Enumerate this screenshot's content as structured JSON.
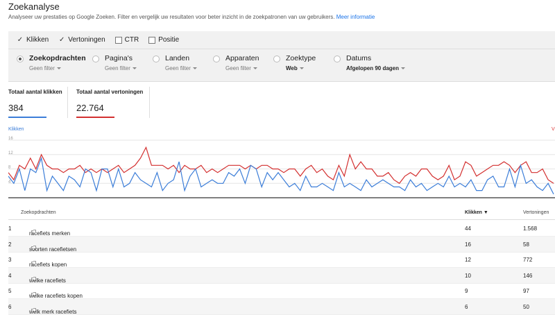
{
  "header": {
    "title": "Zoekanalyse",
    "subtitle": "Analyseer uw prestaties op Google Zoeken. Filter en vergelijk uw resultaten voor beter inzicht in de zoekpatronen van uw gebruikers.",
    "link": "Meer informatie"
  },
  "metrics": [
    {
      "label": "Klikken",
      "checked": true
    },
    {
      "label": "Vertoningen",
      "checked": true
    },
    {
      "label": "CTR",
      "checked": false
    },
    {
      "label": "Positie",
      "checked": false
    }
  ],
  "dimensions": [
    {
      "label": "Zoekopdrachten",
      "sub": "Geen filter",
      "selected": true
    },
    {
      "label": "Pagina's",
      "sub": "Geen filter",
      "selected": false
    },
    {
      "label": "Landen",
      "sub": "Geen filter",
      "selected": false
    },
    {
      "label": "Apparaten",
      "sub": "Geen filter",
      "selected": false
    },
    {
      "label": "Zoektype",
      "sub": "Web",
      "selected": false
    },
    {
      "label": "Datums",
      "sub": "Afgelopen 90 dagen",
      "selected": false
    }
  ],
  "stats": {
    "clicks_label": "Totaal aantal klikken",
    "clicks_value": "384",
    "impr_label": "Totaal aantal vertoningen",
    "impr_value": "22.764"
  },
  "colors": {
    "clicks": "#3b7dd8",
    "impressions": "#d32f2f"
  },
  "chart_data": {
    "type": "line",
    "legend_left": "Klikken",
    "legend_right": "V",
    "yticks": [
      "16",
      "12",
      "8",
      "4"
    ],
    "ylim": [
      0,
      16
    ],
    "series": [
      {
        "name": "Klikken",
        "values": [
          6,
          4,
          8,
          2,
          8,
          7,
          11,
          2,
          6,
          4,
          2,
          6,
          5,
          3,
          8,
          7,
          2,
          8,
          8,
          3,
          8,
          3,
          4,
          7,
          5,
          4,
          3,
          7,
          2,
          4,
          5,
          10,
          2,
          6,
          8,
          3,
          4,
          5,
          4,
          4,
          7,
          6,
          8,
          4,
          9,
          8,
          3,
          7,
          5,
          7,
          5,
          3,
          4,
          2,
          6,
          3,
          3,
          4,
          3,
          2,
          7,
          3,
          4,
          3,
          2,
          5,
          3,
          4,
          5,
          4,
          3,
          3,
          2,
          5,
          3,
          4,
          2,
          3,
          4,
          3,
          6,
          3,
          4,
          3,
          5,
          2,
          2,
          5,
          6,
          3,
          3,
          8,
          3,
          9,
          4,
          5,
          3,
          2,
          4,
          1
        ]
      },
      {
        "name": "Vertoningen",
        "values": [
          7,
          5,
          9,
          8,
          11,
          8,
          12,
          9,
          8,
          8,
          7,
          8,
          8,
          9,
          7,
          8,
          7,
          8,
          7,
          8,
          9,
          7,
          8,
          9,
          11,
          14,
          9,
          9,
          9,
          8,
          9,
          7,
          9,
          8,
          8,
          9,
          7,
          8,
          7,
          8,
          9,
          9,
          9,
          8,
          9,
          8,
          9,
          9,
          8,
          8,
          7,
          8,
          8,
          6,
          8,
          9,
          7,
          8,
          6,
          5,
          9,
          6,
          12,
          8,
          10,
          8,
          8,
          6,
          6,
          7,
          5,
          4,
          6,
          7,
          6,
          8,
          8,
          6,
          5,
          6,
          9,
          5,
          6,
          10,
          9,
          6,
          7,
          8,
          9,
          9,
          10,
          9,
          7,
          9,
          10,
          7,
          7,
          8,
          5,
          4
        ]
      }
    ]
  },
  "table": {
    "headers": {
      "query": "Zoekopdrachten",
      "clicks": "Klikken ▼",
      "impr": "Vertoningen"
    },
    "rows": [
      {
        "n": "1",
        "query": "racefiets merken",
        "clicks": "44",
        "impr": "1.568"
      },
      {
        "n": "2",
        "query": "soorten racefietsen",
        "clicks": "16",
        "impr": "58"
      },
      {
        "n": "3",
        "query": "racefiets kopen",
        "clicks": "12",
        "impr": "772"
      },
      {
        "n": "4",
        "query": "welke racefiets",
        "clicks": "10",
        "impr": "146"
      },
      {
        "n": "5",
        "query": "welke racefiets kopen",
        "clicks": "9",
        "impr": "97"
      },
      {
        "n": "6",
        "query": "welk merk racefiets",
        "clicks": "6",
        "impr": "50"
      }
    ]
  }
}
